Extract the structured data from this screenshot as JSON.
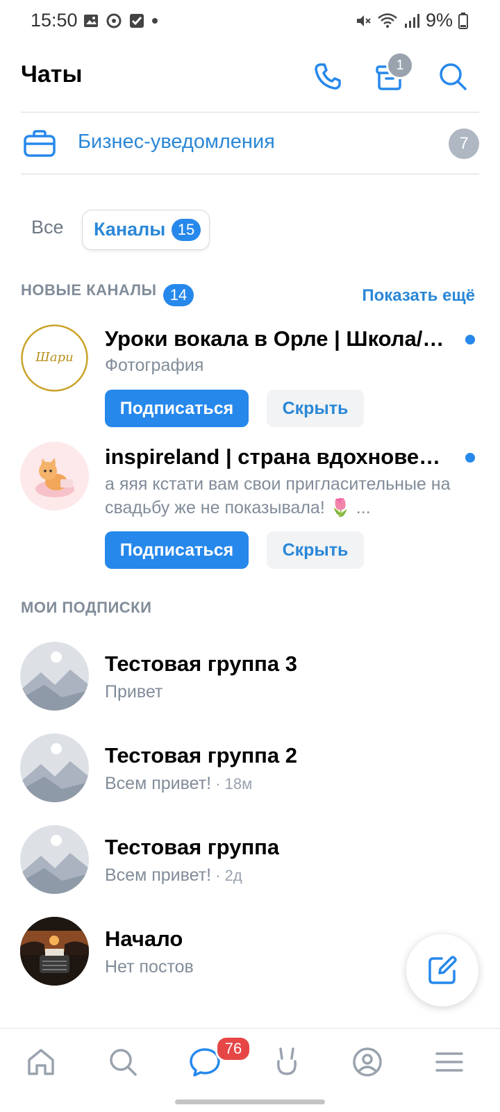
{
  "status_bar": {
    "time": "15:50",
    "battery": "9%"
  },
  "header": {
    "title": "Чаты",
    "archive_badge": "1"
  },
  "business": {
    "label": "Бизнес-уведомления",
    "count": "7"
  },
  "tabs": {
    "all": "Все",
    "channels": "Каналы",
    "channels_count": "15"
  },
  "new_channels": {
    "title": "НОВЫЕ КАНАЛЫ",
    "count": "14",
    "show_more": "Показать ещё",
    "items": [
      {
        "title": "Уроки вокала в Орле | Школа/ с...",
        "subtitle": "Фотография",
        "avatar_text": "Шари",
        "subscribe": "Подписаться",
        "hide": "Скрыть"
      },
      {
        "title": "inspireland | страна вдохновения",
        "subtitle": "а яяя кстати вам свои пригласительные на свадьбу же не показывала! 🌷 ...",
        "subscribe": "Подписаться",
        "hide": "Скрыть"
      }
    ]
  },
  "my_subscriptions": {
    "title": "МОИ ПОДПИСКИ",
    "items": [
      {
        "title": "Тестовая группа 3",
        "subtitle": "Привет",
        "time": ""
      },
      {
        "title": "Тестовая группа 2",
        "subtitle": "Всем привет!",
        "time": "18м"
      },
      {
        "title": "Тестовая группа",
        "subtitle": "Всем привет!",
        "time": "2д"
      },
      {
        "title": "Начало",
        "subtitle": "Нет постов",
        "time": ""
      }
    ]
  },
  "bottom_nav": {
    "messages_badge": "76"
  },
  "colors": {
    "accent": "#2688eb",
    "link": "#2a87d7",
    "secondary_text": "#818c99",
    "badge_red": "#e64646"
  }
}
